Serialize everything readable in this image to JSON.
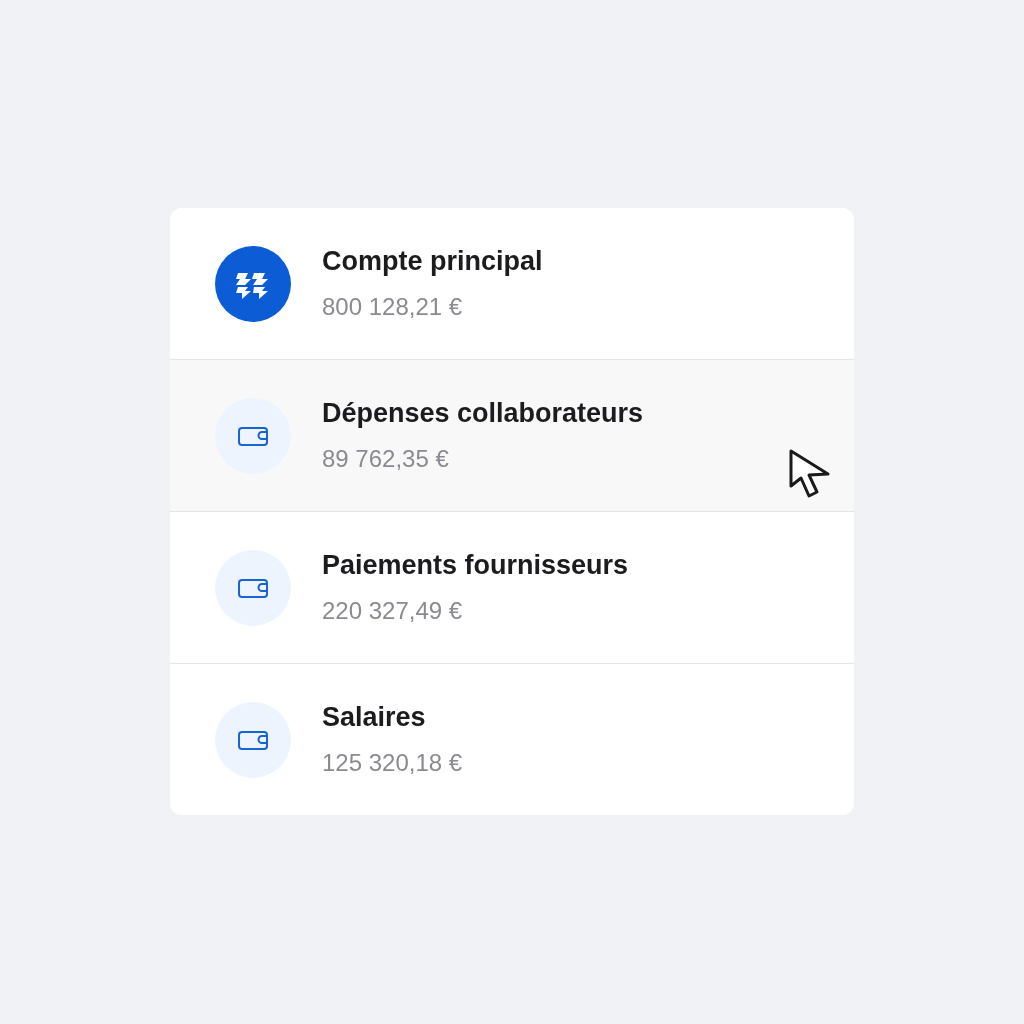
{
  "accounts": [
    {
      "kind": "main",
      "name": "Compte principal",
      "balance": "800 128,21 €",
      "hovered": false
    },
    {
      "kind": "wallet",
      "name": "Dépenses collaborateurs",
      "balance": "89 762,35 €",
      "hovered": true
    },
    {
      "kind": "wallet",
      "name": "Paiements fournisseurs",
      "balance": "220 327,49 €",
      "hovered": false
    },
    {
      "kind": "wallet",
      "name": "Salaires",
      "balance": "125 320,18 €",
      "hovered": false
    }
  ]
}
